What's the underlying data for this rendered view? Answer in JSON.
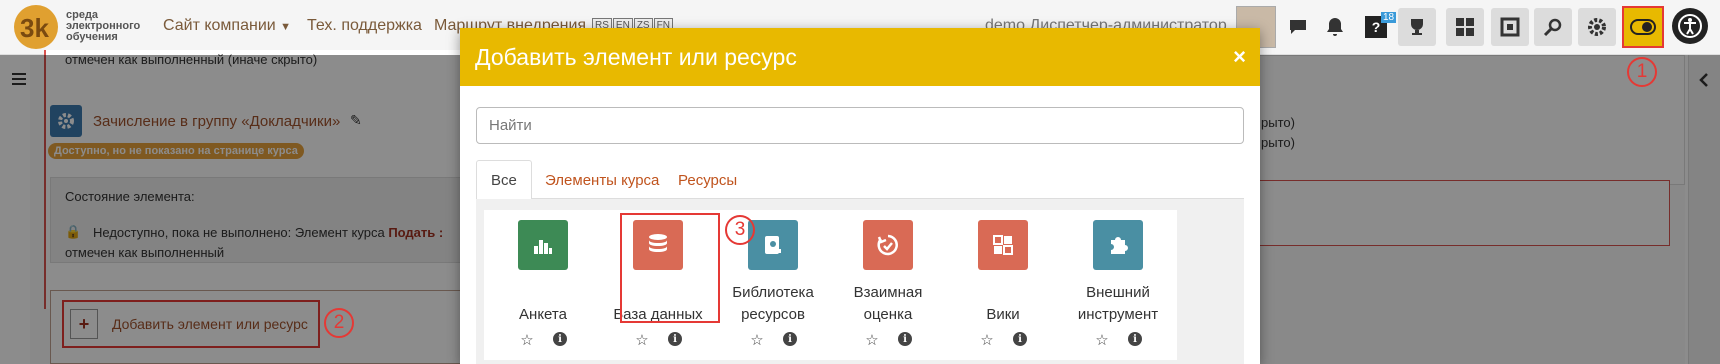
{
  "navbar": {
    "logo_text": [
      "среда",
      "электронного",
      "обучения"
    ],
    "links": [
      "Сайт компании",
      "Тех. поддержка",
      "Маршрут внедрения"
    ],
    "languages": [
      "RS",
      "EN",
      "ZS",
      "FN"
    ],
    "user": "demo Диспетчер-администратор",
    "messages_count": "18"
  },
  "background": {
    "top_text": "отмечен как выполненный (иначе скрыто)",
    "activity_title": "Зачисление в группу «Докладчики»",
    "badge": "Доступно, но не показано на странице курса",
    "state_label": "Состояние элемента:",
    "restriction_prefix": "Недоступно, пока не выполнено: Элемент курса",
    "restriction_bold": "Подать :",
    "restriction_tail": "отмечен как выполненный",
    "add_button": "Добавить элемент или ресурс",
    "right_line1": "рыто)",
    "right_line2": "рыто)"
  },
  "modal": {
    "title": "Добавить элемент или ресурс",
    "close": "×",
    "search_placeholder": "Найти",
    "tabs": [
      "Все",
      "Элементы курса",
      "Ресурсы"
    ],
    "cards": [
      {
        "name": "Анкета",
        "color": "#3d8a55",
        "icon": "chart-icon"
      },
      {
        "name": "База данных",
        "color": "#d96a55",
        "icon": "database-icon"
      },
      {
        "name": "Библиотека ресурсов",
        "color": "#4a8fa3",
        "icon": "library-icon"
      },
      {
        "name": "Взаимная оценка",
        "color": "#d96a55",
        "icon": "workshop-icon"
      },
      {
        "name": "Вики",
        "color": "#d96a55",
        "icon": "wiki-icon"
      },
      {
        "name": "Внешний инструмент",
        "color": "#4a8fa3",
        "icon": "puzzle-icon"
      }
    ]
  },
  "annotations": [
    "1",
    "2",
    "3"
  ]
}
